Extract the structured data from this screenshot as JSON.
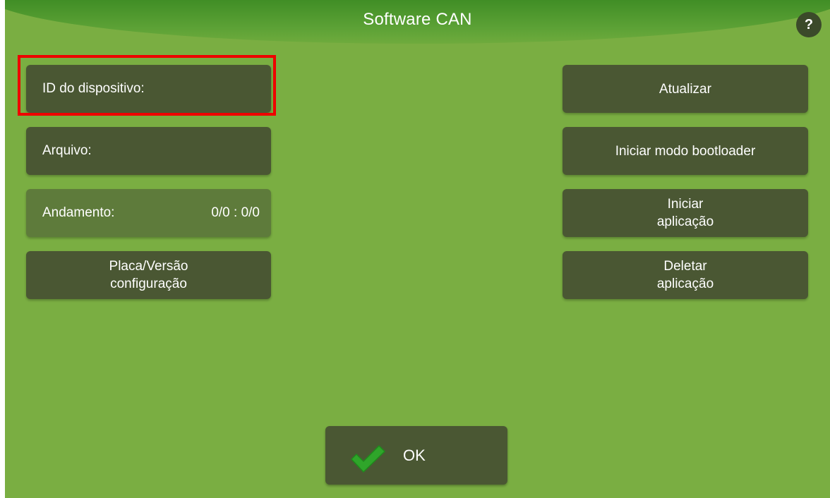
{
  "header": {
    "title": "Software CAN",
    "help_label": "?"
  },
  "left_panel": {
    "device_id_label": "ID do dispositivo:",
    "file_label": "Arquivo:",
    "progress_label": "Andamento:",
    "progress_value": "0/0 : 0/0",
    "board_version": {
      "line1": "Placa/Versão",
      "line2": "configuração"
    }
  },
  "right_panel": {
    "update_label": "Atualizar",
    "bootloader_label": "Iniciar modo bootloader",
    "start_app": {
      "line1": "Iniciar",
      "line2": "aplicação"
    },
    "delete_app": {
      "line1": "Deletar",
      "line2": "aplicação"
    }
  },
  "footer": {
    "ok_label": "OK"
  },
  "colors": {
    "background": "#7aae42",
    "button": "#4a5733",
    "button_disabled": "#5e7b3b",
    "title_bar": "#3f8d25",
    "highlight": "#ee0000",
    "check": "#2fa52a"
  },
  "icons": {
    "help": "question-mark-icon",
    "ok": "checkmark-icon"
  }
}
